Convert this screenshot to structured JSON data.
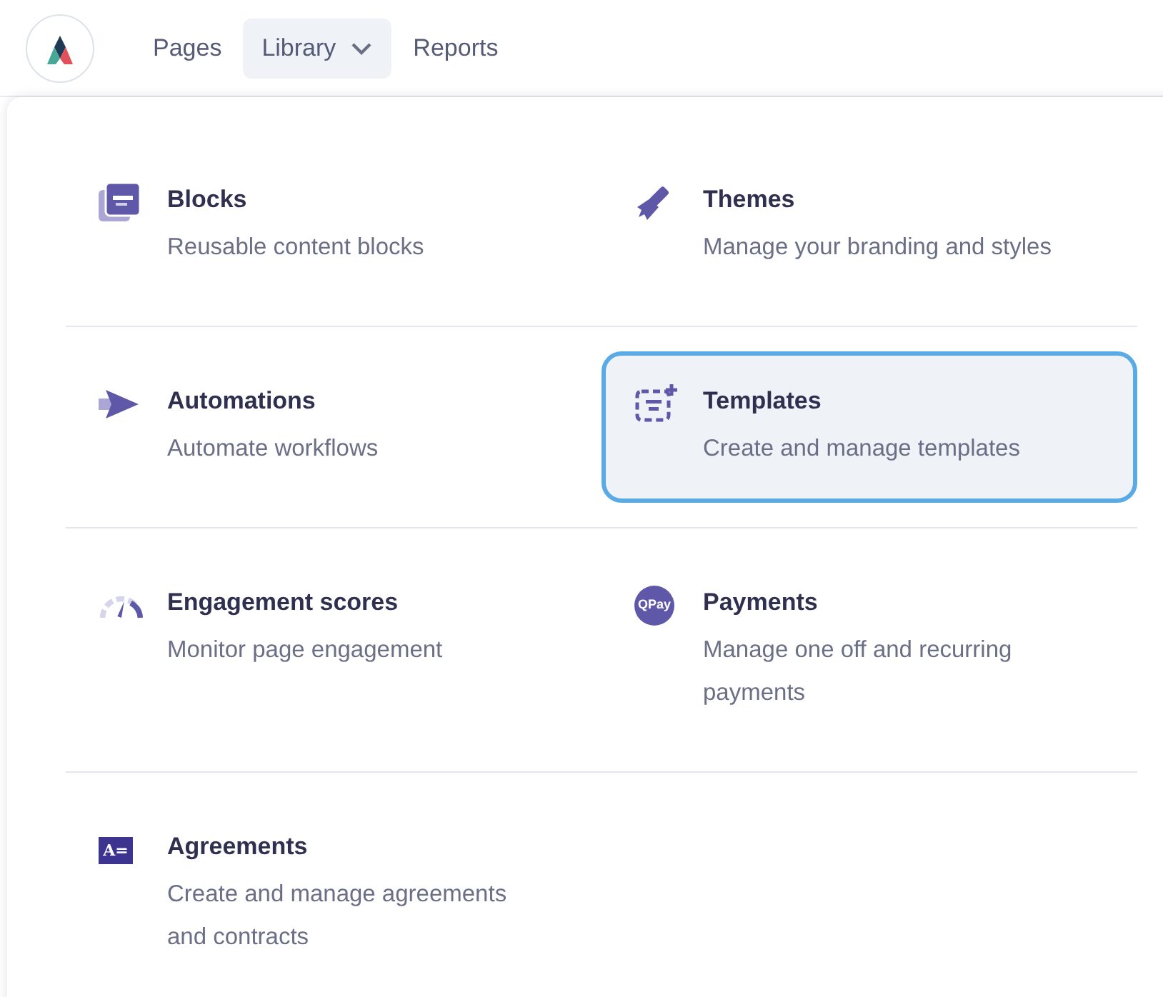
{
  "nav": {
    "items": [
      {
        "label": "Pages",
        "selected": false,
        "dropdown": false
      },
      {
        "label": "Library",
        "selected": true,
        "dropdown": true
      },
      {
        "label": "Reports",
        "selected": false,
        "dropdown": false
      }
    ]
  },
  "menu": {
    "rows": [
      [
        {
          "kind": "blocks",
          "title": "Blocks",
          "description": "Reusable content blocks",
          "selected": false
        },
        {
          "kind": "themes",
          "title": "Themes",
          "description": "Manage your branding and styles",
          "selected": false
        }
      ],
      [
        {
          "kind": "automations",
          "title": "Automations",
          "description": "Automate workflows",
          "selected": false
        },
        {
          "kind": "templates",
          "title": "Templates",
          "description": "Create and manage templates",
          "selected": true
        }
      ],
      [
        {
          "kind": "engagement",
          "title": "Engagement scores",
          "description": "Monitor page engagement",
          "selected": false
        },
        {
          "kind": "payments",
          "title": "Payments",
          "description": "Manage one off and recurring payments",
          "selected": false,
          "icon_text": "QPay"
        }
      ],
      [
        {
          "kind": "agreements",
          "title": "Agreements",
          "description": "Create and manage agreements and contracts",
          "selected": false,
          "icon_text": "A="
        }
      ]
    ]
  }
}
